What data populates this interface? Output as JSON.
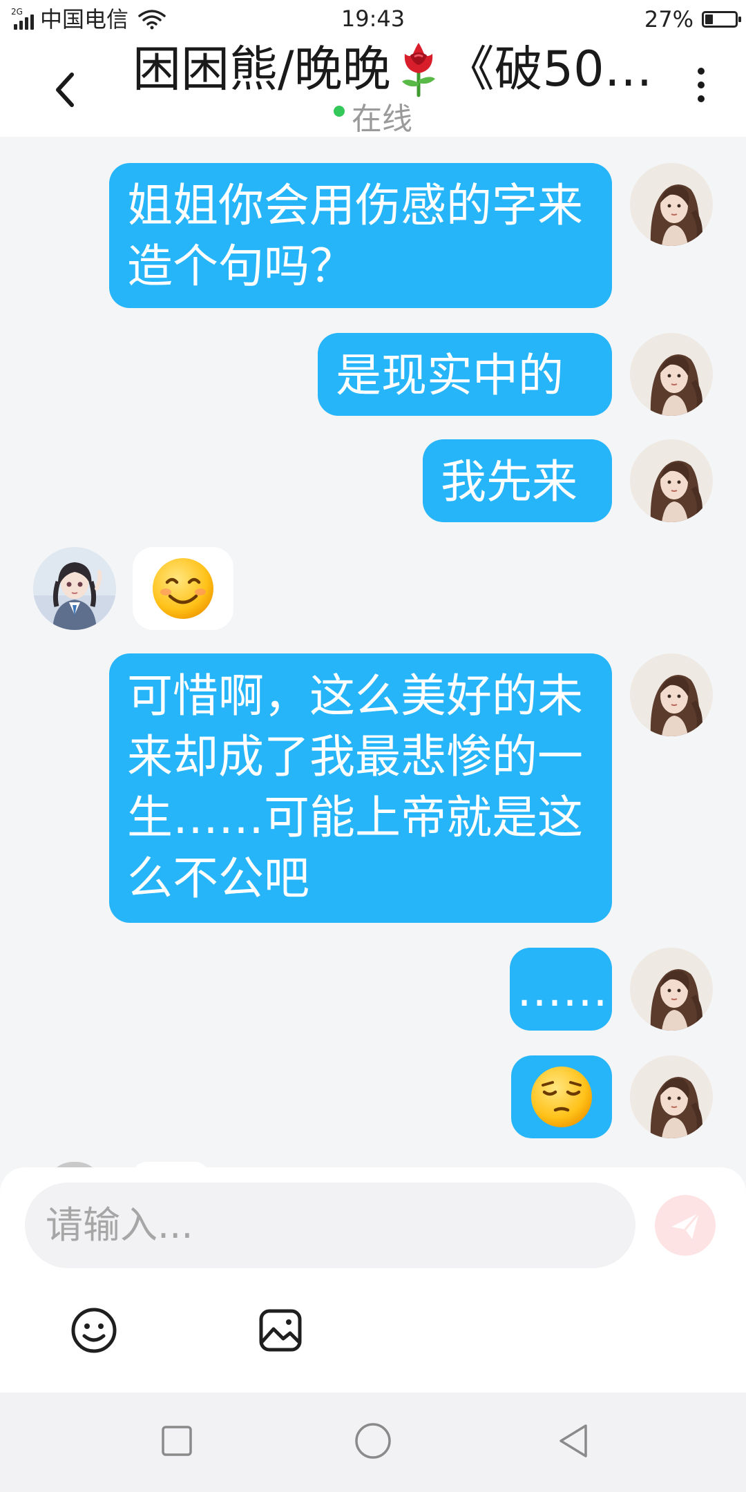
{
  "status_bar": {
    "network_type": "2G",
    "carrier": "中国电信",
    "time": "19:43",
    "battery_percent": "27%",
    "battery_level": 0.27
  },
  "header": {
    "title_part1": "困困熊/晚晚",
    "title_part2": "《破50…",
    "presence": "在线"
  },
  "messages": [
    {
      "side": "right",
      "type": "text",
      "text": "姐姐你会用伤感的字来造个句吗？"
    },
    {
      "side": "right",
      "type": "text",
      "text": "是现实中的"
    },
    {
      "side": "right",
      "type": "text",
      "text": "我先来"
    },
    {
      "side": "left",
      "type": "emoji",
      "emoji": "smiling-face"
    },
    {
      "side": "right",
      "type": "text",
      "text": "可惜啊，这么美好的未来却成了我最悲惨的一生……可能上帝就是这么不公吧"
    },
    {
      "side": "right",
      "type": "text",
      "text": "……"
    },
    {
      "side": "right",
      "type": "emoji",
      "emoji": "pensive-face"
    }
  ],
  "input": {
    "placeholder": "请输入..."
  },
  "colors": {
    "bubble_blue": "#27b5fa",
    "background": "#f4f5f7",
    "presence_dot": "#34c759",
    "send_button": "#fde3e3"
  }
}
